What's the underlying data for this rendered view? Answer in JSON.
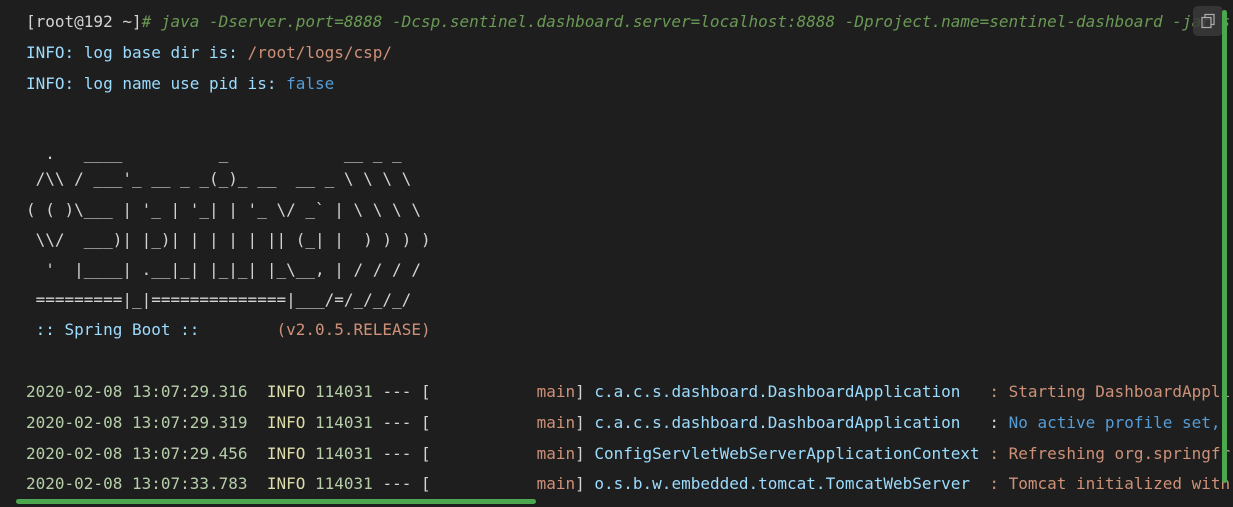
{
  "prompt": {
    "user_host": "[root@192 ~]",
    "command": "# java -Dserver.port=8888 -Dcsp.sentinel.dashboard.server=localhost:8888 -Dproject.name=sentinel-dashboard -jar s"
  },
  "info_lines": [
    {
      "label": "INFO: log base dir is: ",
      "value": "/root/logs/csp/"
    },
    {
      "label": "INFO: log name use pid is: ",
      "value": "false"
    }
  ],
  "banner": [
    "  .   ____          _            __ _ _",
    " /\\\\ / ___'_ __ _ _(_)_ __  __ _ \\ \\ \\ \\",
    "( ( )\\___ | '_ | '_| | '_ \\/ _` | \\ \\ \\ \\",
    " \\\\/  ___)| |_)| | | | | || (_| |  ) ) ) )",
    "  '  |____| .__|_| |_|_| |_\\__, | / / / /",
    " =========|_|==============|___/=/_/_/_/"
  ],
  "spring_boot": {
    "label": " :: Spring Boot :: ",
    "version": "       (v2.0.5.RELEASE)"
  },
  "logs": [
    {
      "date": "2020-02-08 13:07:29.316",
      "level": "INFO",
      "pid": "114031",
      "sep": "--- [",
      "thread": "           main",
      "logger": "c.a.c.s.dashboard.DashboardApplication  ",
      "msg_prefix": "",
      "msg": ": Starting DashboardAppli"
    },
    {
      "date": "2020-02-08 13:07:29.319",
      "level": "INFO",
      "pid": "114031",
      "sep": "--- [",
      "thread": "           main",
      "logger": "c.a.c.s.dashboard.DashboardApplication  ",
      "msg_prefix": ": ",
      "msg": "No active profile set,"
    },
    {
      "date": "2020-02-08 13:07:29.456",
      "level": "INFO",
      "pid": "114031",
      "sep": "--- [",
      "thread": "           main",
      "logger": "ConfigServletWebServerApplicationContext",
      "msg_prefix": "",
      "msg": ": Refreshing org.springfr"
    },
    {
      "date": "2020-02-08 13:07:33.783",
      "level": "INFO",
      "pid": "114031",
      "sep": "--- [",
      "thread": "           main",
      "logger": "o.s.b.w.embedded.tomcat.TomcatWebServer ",
      "msg_prefix": "",
      "msg": ": Tomcat initialized with"
    }
  ],
  "icons": {
    "copy": "copy-icon"
  }
}
